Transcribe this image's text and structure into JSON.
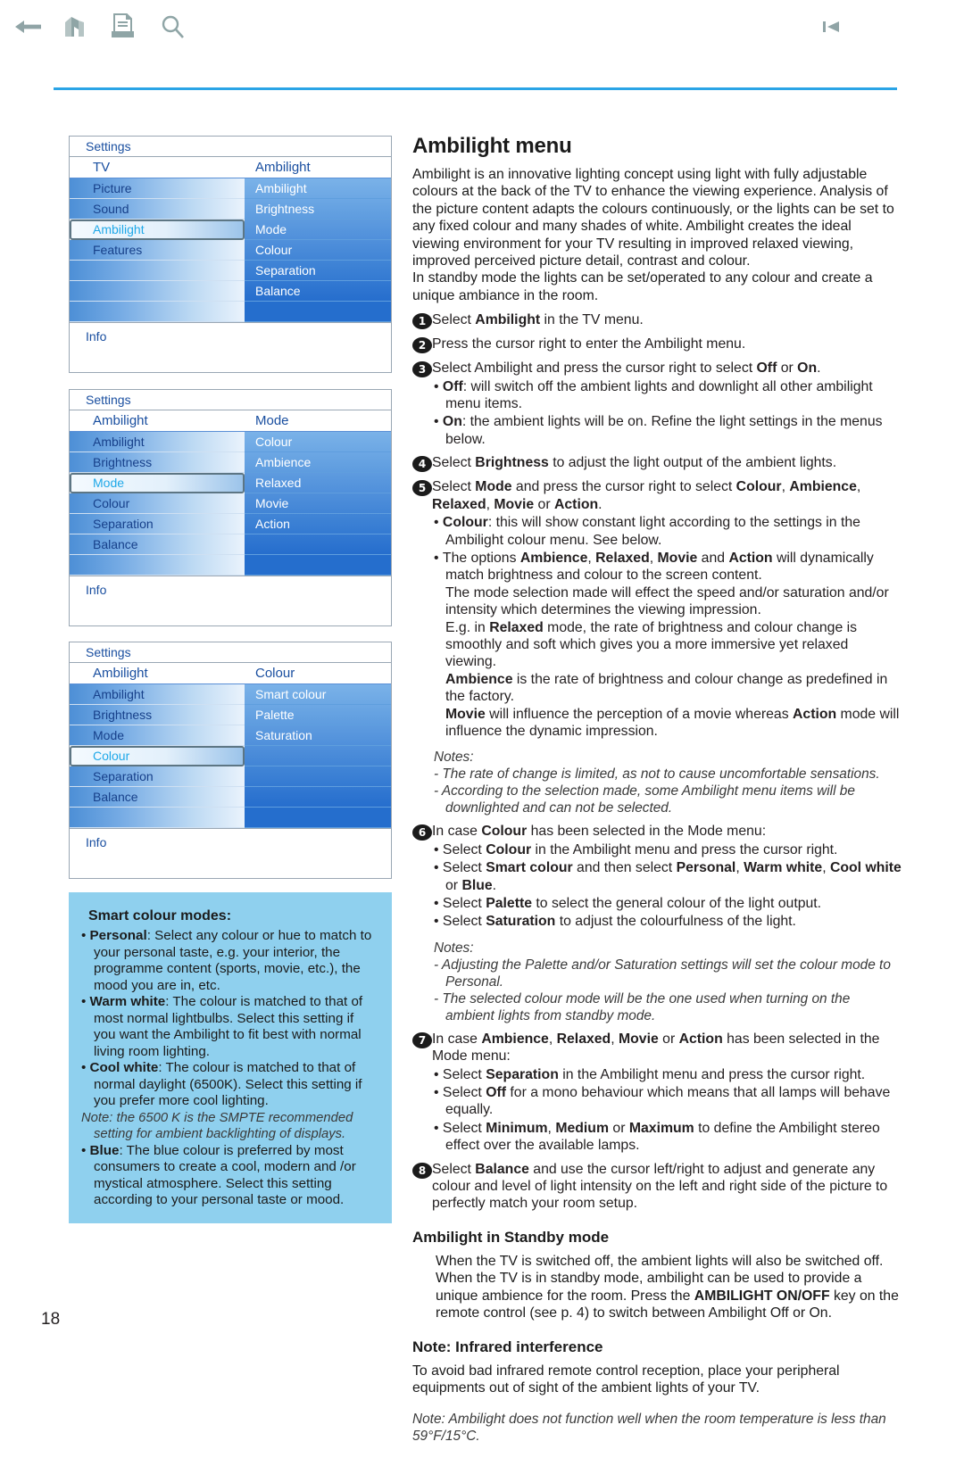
{
  "toolbar": {
    "icons": [
      {
        "name": "back-arrow-icon"
      },
      {
        "name": "home-icon"
      },
      {
        "name": "print-icon"
      },
      {
        "name": "search-icon"
      },
      {
        "name": "skip-back-icon"
      }
    ]
  },
  "page_number": "18",
  "accent_color": "#2aa4e6",
  "callout_color": "#8fd0ee",
  "menus": [
    {
      "title": "Settings",
      "head_left": "TV",
      "head_right": "Ambilight",
      "left_items": [
        "Picture",
        "Sound",
        "Ambilight",
        "Features",
        "",
        "",
        ""
      ],
      "left_selected": 2,
      "right_items": [
        "Ambilight",
        "Brightness",
        "Mode",
        "Colour",
        "Separation",
        "Balance",
        ""
      ],
      "footer": "Info"
    },
    {
      "title": "Settings",
      "head_left": "Ambilight",
      "head_right": "Mode",
      "left_items": [
        "Ambilight",
        "Brightness",
        "Mode",
        "Colour",
        "Separation",
        "Balance",
        ""
      ],
      "left_selected": 2,
      "right_items": [
        "Colour",
        "Ambience",
        "Relaxed",
        "Movie",
        "Action",
        "",
        ""
      ],
      "footer": "Info"
    },
    {
      "title": "Settings",
      "head_left": "Ambilight",
      "head_right": "Colour",
      "left_items": [
        "Ambilight",
        "Brightness",
        "Mode",
        "Colour",
        "Separation",
        "Balance",
        ""
      ],
      "left_selected": 3,
      "right_items": [
        "Smart colour",
        "Palette",
        "Saturation",
        "",
        "",
        "",
        ""
      ],
      "footer": "Info"
    }
  ],
  "smart_box": {
    "heading": "Smart colour modes:",
    "items": [
      {
        "bold": "Personal",
        "rest": ": Select any colour or hue to match to your personal taste, e.g. your interior, the programme content (sports, movie, etc.), the mood you are in, etc."
      },
      {
        "bold": "Warm white",
        "rest": ": The colour is matched to that of most normal lightbulbs. Select this setting if you want the Ambilight to fit best with normal living room lighting."
      },
      {
        "bold": "Cool white",
        "rest": ": The colour is matched to that of normal daylight (6500K). Select this setting if you prefer more cool lighting."
      },
      {
        "bold": "Blue",
        "rest": ": The blue colour is preferred by most consumers to create a cool, modern and /or mystical atmosphere. Select this setting according to your personal taste or mood."
      }
    ],
    "note": "Note: the 6500 K is the SMPTE recommended setting for ambient backlighting of displays."
  },
  "main": {
    "title": "Ambilight menu",
    "intro1": "Ambilight is an innovative lighting concept using light with fully adjustable colours at the back of the TV to enhance the viewing experience. Analysis of the picture content adapts the colours continuously, or the lights can be set to any fixed colour and many shades of white. Ambilight creates the ideal viewing environment for your TV resulting in improved relaxed viewing, improved perceived picture detail, contrast and colour.",
    "intro2": "In standby mode the lights can be set/operated to any colour and create a unique ambiance in the room.",
    "step1": "Select <b>Ambilight</b> in the TV menu.",
    "step2": "Press the cursor right to enter the Ambilight menu.",
    "step3": "Select Ambilight and press the cursor right to select <b>Off</b> or <b>On</b>.",
    "step3_b1": "<b>Off</b>: will switch off the ambient lights and downlight all other ambilight menu items.",
    "step3_b2": "<b>On</b>: the ambient lights will be on.  Refine the light settings in the menus below.",
    "step4": "Select <b>Brightness</b> to adjust the light output of the ambient lights.",
    "step5": "Select <b>Mode</b> and press the cursor right to select <b>Colour</b>, <b>Ambience</b>, <b>Relaxed</b>, <b>Movie</b> or <b>Action</b>.",
    "step5_b1": "<b>Colour</b>: this will show constant light according to the settings in the Ambilight colour menu. See below.",
    "step5_b2": "The options <b>Ambience</b>, <b>Relaxed</b>, <b>Movie</b> and <b>Action</b> will dynamically match brightness and colour to the screen content.",
    "step5_p1": "The mode selection made will effect the speed and/or saturation and/or intensity which determines the viewing impression.",
    "step5_p2": "E.g. in <b>Relaxed</b> mode, the rate of brightness and colour change is smoothly and soft which gives you a more immersive yet relaxed viewing.",
    "step5_p3": "<b>Ambience</b> is the rate of brightness and colour change as predefined in the factory.",
    "step5_p4": "<b>Movie</b> will influence the perception of a movie whereas <b>Action</b> mode will influence the dynamic impression.",
    "notes1_title": "Notes:",
    "notes1_a": "- The rate of change is limited, as not to cause uncomfortable sensations.",
    "notes1_b": "- According to the selection made, some Ambilight menu items will be downlighted and can not be selected.",
    "step6": "In case <b>Colour</b> has been selected in the Mode menu:",
    "step6_b1": "Select <b>Colour</b> in the Ambilight menu and press the cursor right.",
    "step6_b2": "Select <b>Smart colour</b> and then select <b>Personal</b>, <b>Warm white</b>, <b>Cool white</b> or <b>Blue</b>.",
    "step6_b3": "Select <b>Palette</b> to select the general colour of the light output.",
    "step6_b4": "Select <b>Saturation</b> to adjust the colourfulness of the light.",
    "notes2_title": "Notes:",
    "notes2_a": "- Adjusting the Palette and/or Saturation settings will set the colour mode to Personal.",
    "notes2_b": "- The selected colour mode will be the one used when turning on the ambient lights from standby mode.",
    "step7": "In case <b>Ambience</b>, <b>Relaxed</b>, <b>Movie</b> or <b>Action</b> has been selected in the Mode menu:",
    "step7_b1": "Select <b>Separation</b> in the Ambilight menu and press the cursor right.",
    "step7_b2": "Select <b>Off</b> for a mono behaviour which means that all lamps will behave equally.",
    "step7_b3": "Select <b>Minimum</b>, <b>Medium</b> or <b>Maximum</b> to define the Ambilight stereo effect over the available lamps.",
    "step8": "Select <b>Balance</b> and use the cursor left/right to adjust and generate any colour and level of light intensity on the left and right side of the picture to perfectly match your room setup.",
    "standby_heading": "Ambilight in Standby mode",
    "standby_body": "When the TV is switched off, the ambient lights will also be switched off. When the TV is in standby mode, ambilight can be used to provide a unique ambience for the room. Press the <b>AMBILIGHT ON/OFF</b> key on the remote control (see p. 4) to switch between Ambilight Off or On.",
    "infrared_heading": "Note: Infrared interference",
    "infrared_body": "To avoid bad infrared remote control reception, place your peripheral equipments out of sight of the ambient lights of your TV.",
    "infrared_note": "Note: Ambilight does not function well when the room temperature is less than 59°F/15°C."
  }
}
